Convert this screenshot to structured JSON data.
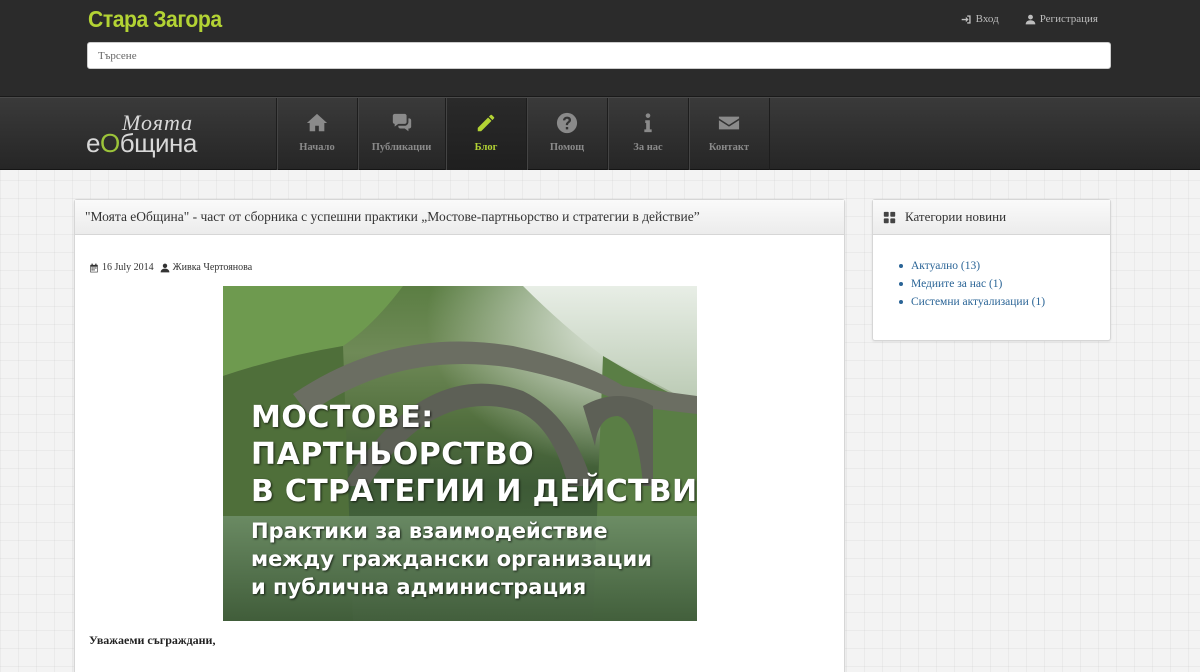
{
  "header": {
    "site_title": "Стара Загора",
    "login_label": "Вход",
    "register_label": "Регистрация",
    "search_placeholder": "Търсене"
  },
  "logo": {
    "top_text": "Моята",
    "bottom_prefix": "е",
    "bottom_accent": "О",
    "bottom_suffix": "бщина"
  },
  "nav": {
    "items": [
      {
        "label": "Начало",
        "icon": "home-icon"
      },
      {
        "label": "Публикации",
        "icon": "comments-icon"
      },
      {
        "label": "Блог",
        "icon": "pencil-icon",
        "active": true
      },
      {
        "label": "Помощ",
        "icon": "question-icon"
      },
      {
        "label": "За нас",
        "icon": "info-icon"
      },
      {
        "label": "Контакт",
        "icon": "envelope-icon"
      }
    ]
  },
  "article": {
    "title": "\"Моята еОбщина\" - част от сборника с успешни практики „Мостове-партньорство и стратегии в действие”",
    "date": "16 July 2014",
    "author": "Живка Чертоянова",
    "image_text": {
      "line1": "МОСТОВЕ:",
      "line2": "ПАРТНЬОРСТВО",
      "line3": "В СТРАТЕГИИ И ДЕЙСТВИЕ",
      "line4": "Практики за взаимодействие",
      "line5": "между граждански организации",
      "line6": "и публична администрация"
    },
    "greeting": "Уважаеми съграждани,"
  },
  "sidebar": {
    "title": "Категории новини",
    "categories": [
      {
        "label": "Актуално (13)"
      },
      {
        "label": "Медиите за нас (1)"
      },
      {
        "label": "Системни актуализации (1)"
      }
    ]
  },
  "colors": {
    "accent": "#b3d334",
    "header_bg": "#2b2b2b",
    "link": "#2a6496"
  }
}
